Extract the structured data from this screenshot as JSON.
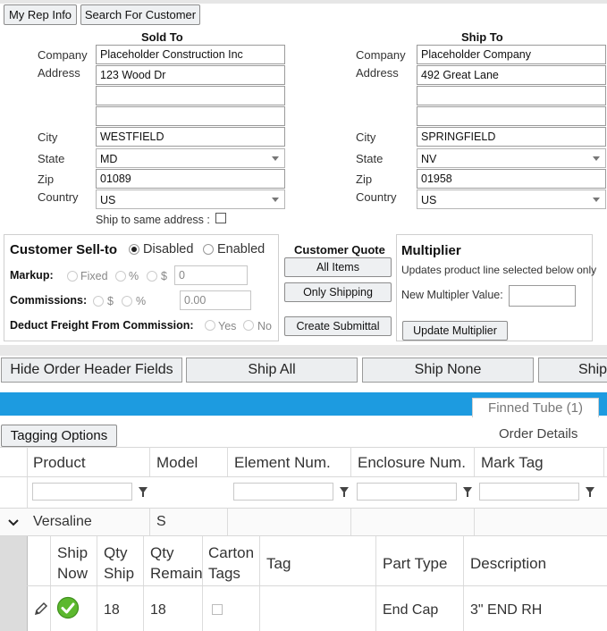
{
  "toolbar": {
    "rep_info": "My Rep Info",
    "search_customer": "Search For Customer"
  },
  "sold_to": {
    "title": "Sold To",
    "company_label": "Company",
    "company": "Placeholder Construction Inc",
    "address_label": "Address",
    "address1": "123 Wood Dr",
    "address2": "",
    "address3": "",
    "city_label": "City",
    "city": "WESTFIELD",
    "state_label": "State",
    "state": "MD",
    "zip_label": "Zip",
    "zip": "01089",
    "country_label": "Country",
    "country": "US",
    "same_address_label": "Ship to same address :"
  },
  "ship_to": {
    "title": "Ship To",
    "company_label": "Company",
    "company": "Placeholder Company",
    "address_label": "Address",
    "address1": "492 Great Lane",
    "address2": "",
    "address3": "",
    "city_label": "City",
    "city": "SPRINGFIELD",
    "state_label": "State",
    "state": "NV",
    "zip_label": "Zip",
    "zip": "01958",
    "country_label": "Country",
    "country": "US"
  },
  "sell_to": {
    "title": "Customer Sell-to",
    "disabled_label": "Disabled",
    "enabled_label": "Enabled",
    "markup_label": "Markup:",
    "fixed_label": "Fixed",
    "pct_label": "%",
    "dollar_label": "$",
    "markup_value": "0",
    "commissions_label": "Commissions:",
    "comm_dollar_label": "$",
    "comm_pct_label": "%",
    "commission_value": "0.00",
    "deduct_label": "Deduct Freight From Commission:",
    "yes_label": "Yes",
    "no_label": "No"
  },
  "quote": {
    "title": "Customer Quote",
    "all_items": "All Items",
    "only_shipping": "Only Shipping",
    "create_submittal": "Create Submittal"
  },
  "multiplier": {
    "title": "Multiplier",
    "desc": "Updates product line selected below only",
    "new_label": "New Multipler Value:",
    "value": "",
    "update_button": "Update Multiplier"
  },
  "actions": {
    "hide_header": "Hide Order Header Fields",
    "ship_all": "Ship All",
    "ship_none": "Ship None",
    "ship_partial": "Ship"
  },
  "tabs": {
    "finned_tube": "Finned Tube (1)"
  },
  "grid_toolbar": {
    "tagging": "Tagging Options",
    "order_details": "Order Details"
  },
  "grid": {
    "headers": [
      "Product",
      "Model",
      "Element Num.",
      "Enclosure Num.",
      "Mark Tag"
    ],
    "row": {
      "product": "Versaline",
      "model": "S"
    }
  },
  "detail": {
    "headers": {
      "ship_now_1": "Ship",
      "ship_now_2": "Now",
      "qty_ship_1": "Qty",
      "qty_ship_2": "Ship",
      "qty_remain_1": "Qty",
      "qty_remain_2": "Remain",
      "carton_1": "Carton",
      "carton_2": "Tags",
      "tag": "Tag",
      "part_type": "Part Type",
      "description": "Description"
    },
    "row": {
      "qty_ship": "18",
      "qty_remain": "18",
      "part_type": "End Cap",
      "description": "3\" END RH"
    }
  },
  "colors": {
    "accent_blue": "#1d9be0",
    "check_green": "#5cb82e"
  }
}
